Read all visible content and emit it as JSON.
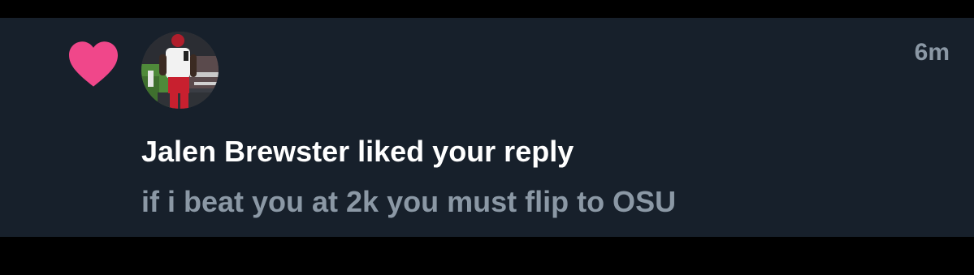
{
  "notification": {
    "type_icon": "heart-icon",
    "avatar_icon": "football-player-avatar",
    "timestamp": "6m",
    "title": "Jalen Brewster liked your reply",
    "excerpt": "if i beat you at 2k you must flip to OSU"
  },
  "colors": {
    "background": "#17202b",
    "heart": "#f0478a",
    "title_text": "#ffffff",
    "secondary_text": "#8b98a5"
  }
}
